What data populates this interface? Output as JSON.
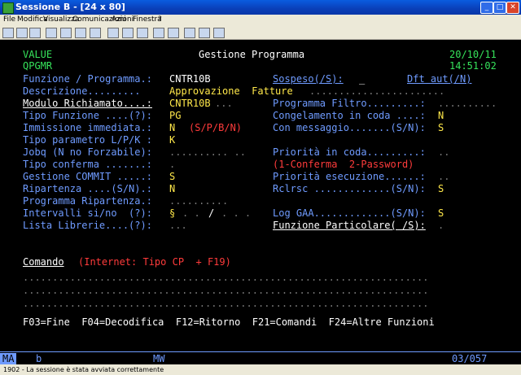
{
  "window": {
    "title": "Sessione B - [24 x 80]",
    "minimize": "_",
    "maximize": "□",
    "close": "✕"
  },
  "menu": [
    "File",
    "Modifica",
    "Visualizza",
    "Comunicazioni",
    "Azioni",
    "Finestra",
    "?"
  ],
  "header": {
    "left1": "VALUE",
    "left2": "QPGMR",
    "title": "Gestione Programma",
    "date": "20/10/11",
    "time": "14:51:02"
  },
  "fields": {
    "funzione_label": "Funzione / Programma.:",
    "funzione_value": "CNTR10B",
    "sospeso_label": "Sospeso(/S):",
    "sospeso_value": "_",
    "dft_label": "Dft aut(/N)",
    "descrizione_label": "Descrizione.........",
    "descrizione_value": "Approvazione  Fatture",
    "modulo_label": "Modulo Richiamato....:",
    "modulo_value": "CNTR10B",
    "prog_filtro_label": "Programma Filtro.........:",
    "tipo_funzione_label": "Tipo Funzione ....(?):",
    "tipo_funzione_value": "PG",
    "congelamento_label": "Congelamento in coda ....:",
    "congelamento_value": "N",
    "immissione_label": "Immissione immediata.:",
    "immissione_value": "N",
    "immissione_hint": "(S/P/B/N)",
    "con_messaggio_label": "Con messaggio.......(S/N):",
    "con_messaggio_value": "S",
    "tipo_param_label": "Tipo parametro L/P/K :",
    "tipo_param_value": "K",
    "jobq_label": "Jobq (N no Forzabile):",
    "priorita_coda_label": "Priorità in coda.........:",
    "tipo_conferma_label": "Tipo conferma .......:",
    "conferma_hint": "(1-Conferma  2-Password)",
    "gestione_commit_label": "Gestione COMMIT .....:",
    "gestione_commit_value": "S",
    "priorita_esec_label": "Priorità esecuzione......:",
    "ripartenza_label": "Ripartenza ....(S/N).:",
    "ripartenza_value": "N",
    "rclrsc_label": "Rclrsc .............(S/N):",
    "rclrsc_value": "S",
    "prog_ripartenza_label": "Programma Ripartenza.:",
    "intervalli_label": "Intervalli si/no  (?):",
    "intervalli_value": "§",
    "intervalli_sep": "/",
    "log_gaa_label": "Log GAA.............(S/N):",
    "log_gaa_value": "S",
    "lista_librerie_label": "Lista Librerie....(?):",
    "funzione_particolare_label": "Funzione Particolare( /S):",
    "comando_label": "Comando",
    "comando_hint": "(Internet: Tipo CP  + F19)"
  },
  "fkeys": "F03=Fine  F04=Decodifica  F12=Ritorno  F21=Comandi  F24=Altre Funzioni",
  "status": {
    "ma": "MA",
    "session": "b",
    "mw": "MW",
    "cursor": "03/057"
  },
  "message": "1902 - La sessione è stata avviata correttamente",
  "colors": {
    "green": "#36e35b",
    "blue": "#6f9bff",
    "white": "#ffffff",
    "yellow": "#ffe84a",
    "red": "#ff3b3b"
  }
}
